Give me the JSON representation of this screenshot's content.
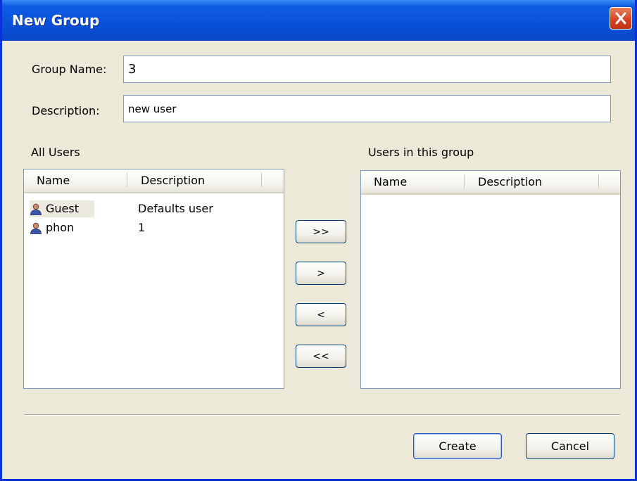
{
  "window": {
    "title": "New Group"
  },
  "form": {
    "group_name_label": "Group Name:",
    "group_name_value": "3",
    "description_label": "Description:",
    "description_value": "new user"
  },
  "all_users": {
    "label": "All Users",
    "columns": [
      "Name",
      "Description"
    ],
    "rows": [
      {
        "name": "Guest",
        "description": "Defaults user",
        "icon": "user-icon"
      },
      {
        "name": "phon",
        "description": "1",
        "icon": "user-icon"
      }
    ]
  },
  "group_users": {
    "label": "Users in this group",
    "columns": [
      "Name",
      "Description"
    ],
    "rows": []
  },
  "transfer_buttons": {
    "add_all": ">>",
    "add": ">",
    "remove": "<",
    "remove_all": "<<"
  },
  "footer": {
    "create": "Create",
    "cancel": "Cancel"
  },
  "colors": {
    "title_bar": "#0a51d9",
    "dialog_bg": "#ece9d8",
    "close_button": "#d4401f",
    "field_border": "#7f9db9",
    "button_border": "#003c74"
  }
}
